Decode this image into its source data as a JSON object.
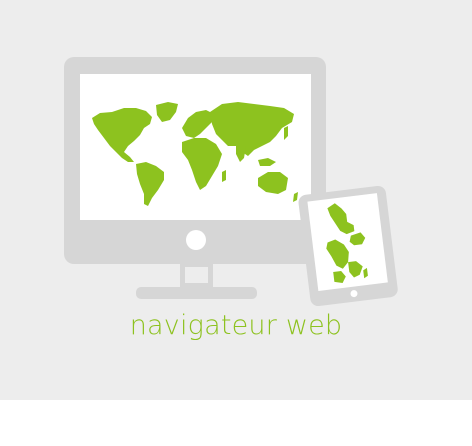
{
  "caption": "navigateur web",
  "colors": {
    "background": "#ededed",
    "device": "#d6d6d6",
    "screen": "#ffffff",
    "map": "#8dc21f",
    "caption": "#8dc21f"
  },
  "icons": {
    "monitor": "desktop-monitor-icon",
    "tablet": "tablet-icon",
    "map": "world-map-icon"
  }
}
